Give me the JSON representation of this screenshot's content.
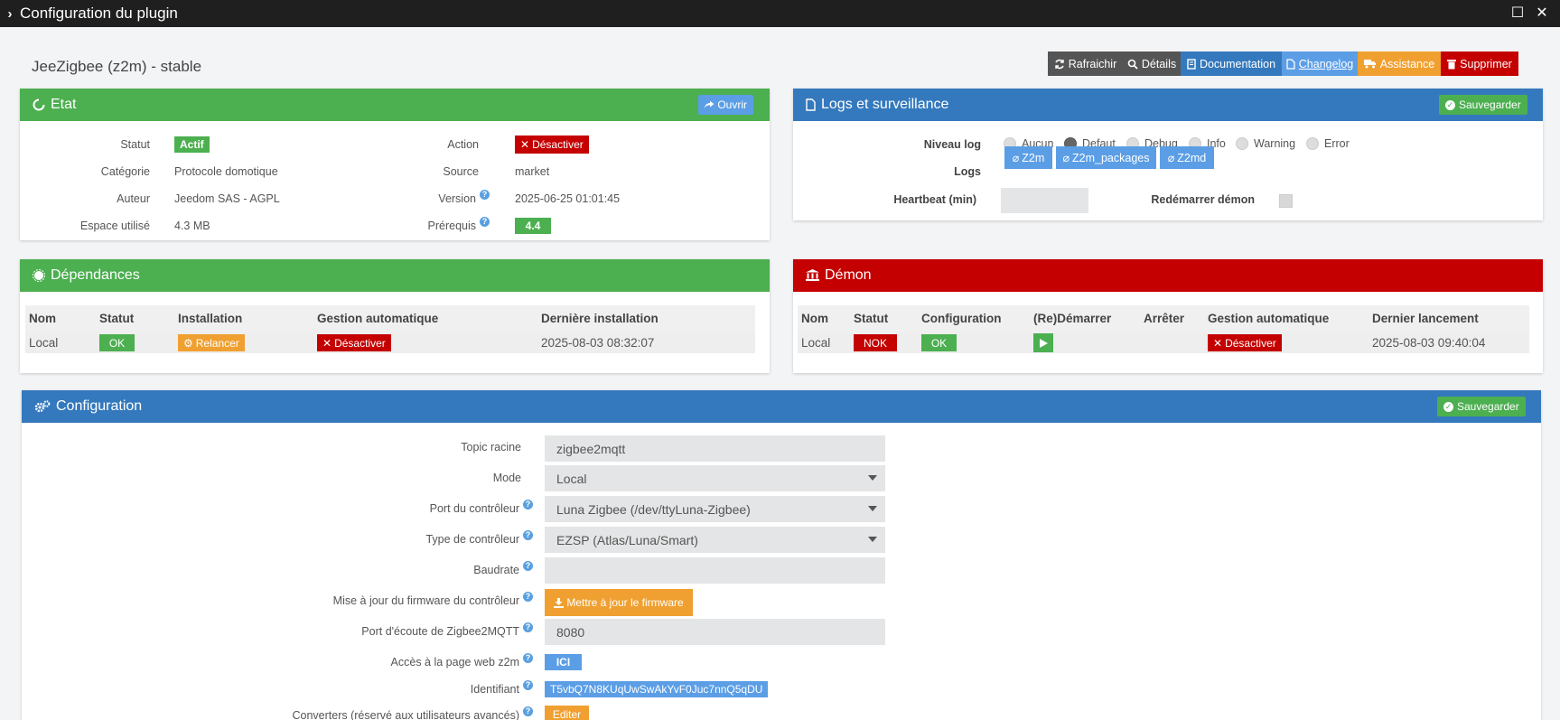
{
  "window": {
    "title": "Configuration du plugin"
  },
  "plugin": {
    "name": "JeeZigbee (z2m) - stable"
  },
  "toolbar": {
    "refresh": "Rafraichir",
    "details": "Détails",
    "documentation": "Documentation",
    "changelog": "Changelog",
    "assistance": "Assistance",
    "delete": "Supprimer"
  },
  "etat": {
    "title": "Etat",
    "open_button": "Ouvrir",
    "statut_label": "Statut",
    "statut_value": "Actif",
    "categorie_label": "Catégorie",
    "categorie_value": "Protocole domotique",
    "auteur_label": "Auteur",
    "auteur_value": "Jeedom SAS - AGPL",
    "espace_label": "Espace utilisé",
    "espace_value": "4.3 MB",
    "action_label": "Action",
    "action_button": "Désactiver",
    "source_label": "Source",
    "source_value": "market",
    "version_label": "Version",
    "version_value": "2025-06-25 01:01:45",
    "prerequis_label": "Prérequis",
    "prerequis_value": "4.4"
  },
  "logs": {
    "title": "Logs et surveillance",
    "save_button": "Sauvegarder",
    "niveau_label": "Niveau log",
    "levels": [
      "Aucun",
      "Defaut",
      "Debug",
      "Info",
      "Warning",
      "Error"
    ],
    "selected_level": "Defaut",
    "logs_label": "Logs",
    "log_buttons": [
      "Z2m",
      "Z2m_packages",
      "Z2md"
    ],
    "heartbeat_label": "Heartbeat (min)",
    "heartbeat_value": "",
    "restart_label": "Redémarrer démon"
  },
  "dependances": {
    "title": "Dépendances",
    "headers": [
      "Nom",
      "Statut",
      "Installation",
      "Gestion automatique",
      "Dernière installation"
    ],
    "row": {
      "nom": "Local",
      "statut": "OK",
      "installation": "Relancer",
      "gestion": "Désactiver",
      "derniere": "2025-08-03 08:32:07"
    }
  },
  "demon": {
    "title": "Démon",
    "headers": [
      "Nom",
      "Statut",
      "Configuration",
      "(Re)Démarrer",
      "Arrêter",
      "Gestion automatique",
      "Dernier lancement"
    ],
    "row": {
      "nom": "Local",
      "statut": "NOK",
      "configuration": "OK",
      "gestion": "Désactiver",
      "dernier": "2025-08-03 09:40:04"
    }
  },
  "configuration": {
    "title": "Configuration",
    "save_button": "Sauvegarder",
    "topic_label": "Topic racine",
    "topic_value": "zigbee2mqtt",
    "mode_label": "Mode",
    "mode_value": "Local",
    "port_label": "Port du contrôleur",
    "port_value": "Luna Zigbee (/dev/ttyLuna-Zigbee)",
    "type_label": "Type de contrôleur",
    "type_value": "EZSP (Atlas/Luna/Smart)",
    "baudrate_label": "Baudrate",
    "baudrate_value": "",
    "firmware_label": "Mise à jour du firmware du contrôleur",
    "firmware_button": "Mettre à jour le firmware",
    "listen_port_label": "Port d'écoute de Zigbee2MQTT",
    "listen_port_value": "8080",
    "web_label": "Accès à la page web z2m",
    "web_button": "ICI",
    "identifiant_label": "Identifiant",
    "identifiant_value": "T5vbQ7N8KUqUwSwAkYvF0Juc7nnQ5qDU",
    "converters_label": "Converters (réservé aux utilisateurs avancés)",
    "converters_button": "Editer"
  },
  "colors": {
    "green": "#4caf50",
    "blue": "#3479bd",
    "red": "#c40000",
    "orange": "#f0a030",
    "light_blue": "#5b9ee6",
    "dark_gray": "#555555"
  }
}
